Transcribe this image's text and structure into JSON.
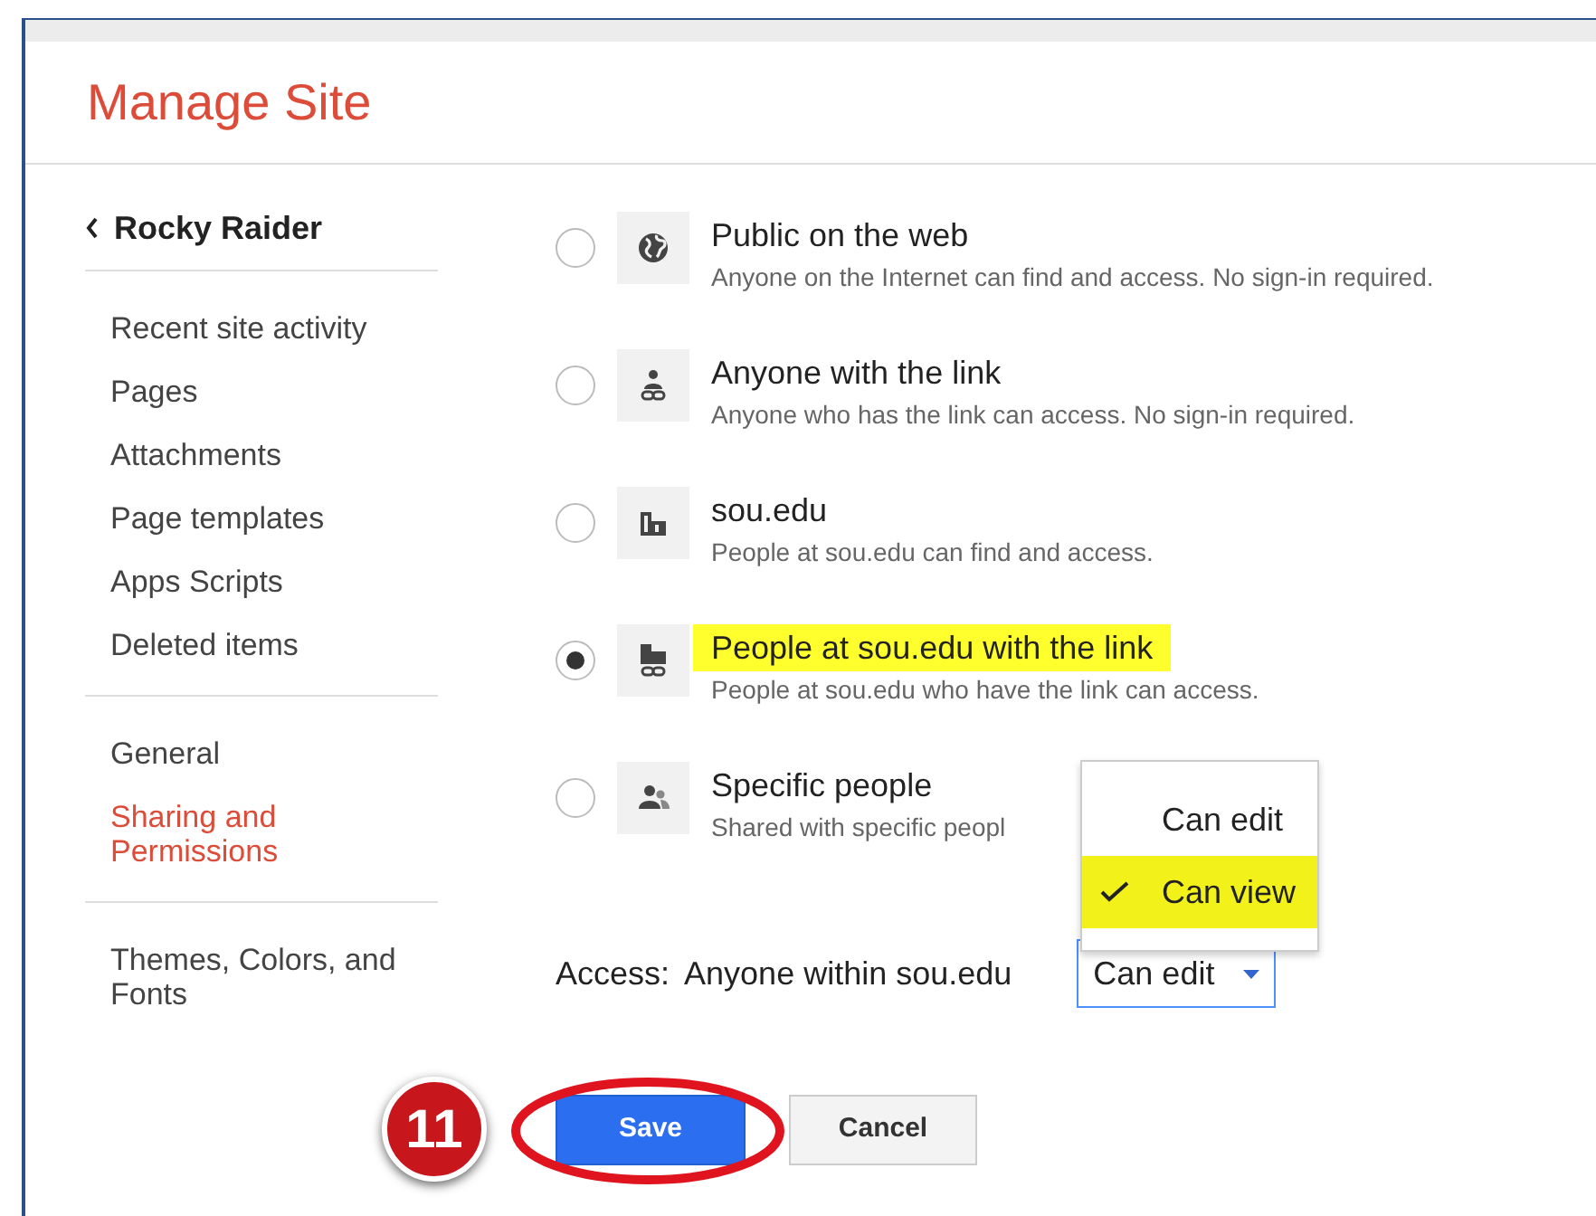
{
  "title": "Manage Site",
  "sidebar": {
    "back": "Rocky Raider",
    "groups": [
      [
        {
          "label": "Recent site activity",
          "selected": false
        },
        {
          "label": "Pages",
          "selected": false
        },
        {
          "label": "Attachments",
          "selected": false
        },
        {
          "label": "Page templates",
          "selected": false
        },
        {
          "label": "Apps Scripts",
          "selected": false
        },
        {
          "label": "Deleted items",
          "selected": false
        }
      ],
      [
        {
          "label": "General",
          "selected": false
        },
        {
          "label": "Sharing and Permissions",
          "selected": true
        }
      ],
      [
        {
          "label": "Themes, Colors, and Fonts",
          "selected": false
        }
      ]
    ]
  },
  "options": [
    {
      "kind": "globe",
      "title": "Public on the web",
      "description": "Anyone on the Internet can find and access. No sign-in required.",
      "selected": false,
      "highlighted": false
    },
    {
      "kind": "person-link",
      "title": "Anyone with the link",
      "description": "Anyone who has the link can access. No sign-in required.",
      "selected": false,
      "highlighted": false
    },
    {
      "kind": "building",
      "title": "sou.edu",
      "description": "People at sou.edu can find and access.",
      "selected": false,
      "highlighted": false
    },
    {
      "kind": "building-link",
      "title": "People at sou.edu with the link",
      "description": "People at sou.edu who have the link can access.",
      "selected": true,
      "highlighted": true
    },
    {
      "kind": "people",
      "title": "Specific people",
      "description": "Shared with specific peopl",
      "selected": false,
      "highlighted": false
    }
  ],
  "access": {
    "label": "Access:",
    "value": "Anyone within sou.edu",
    "select": "Can edit"
  },
  "menu": [
    {
      "label": "Can edit",
      "checked": false,
      "highlighted": false
    },
    {
      "label": "Can view",
      "checked": true,
      "highlighted": true
    }
  ],
  "buttons": {
    "save": "Save",
    "cancel": "Cancel"
  },
  "step_badge": "11"
}
